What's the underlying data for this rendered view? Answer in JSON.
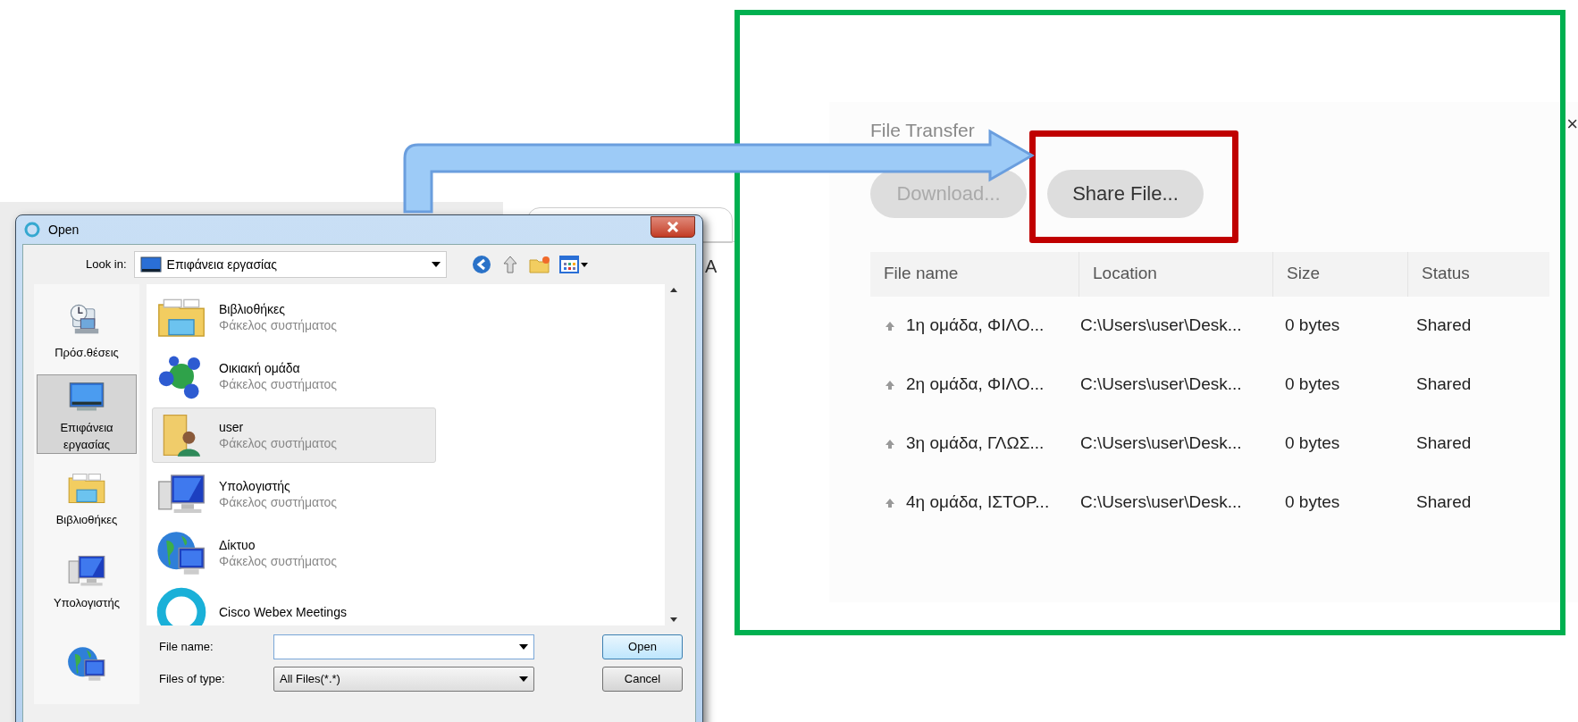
{
  "background_fragments": [
    {
      "kind": "small",
      "text": "A"
    }
  ],
  "open_dialog": {
    "title": "Open",
    "look_in_label": "Look in:",
    "look_in_value": "Επιφάνεια εργασίας",
    "places": [
      {
        "kind": "recent",
        "label": "Πρόσ.θέσεις",
        "selected": false
      },
      {
        "kind": "desktop",
        "label": "Επιφάνεια εργασίας",
        "selected": true
      },
      {
        "kind": "libraries",
        "label": "Βιβλιοθήκες",
        "selected": false
      },
      {
        "kind": "computer",
        "label": "Υπολογιστής",
        "selected": false
      },
      {
        "kind": "network",
        "selected": false
      }
    ],
    "items": [
      {
        "kind": "libraries",
        "name": "Βιβλιοθήκες",
        "type": "Φάκελος συστήματος",
        "selected": false
      },
      {
        "kind": "homegroup",
        "name": "Οικιακή ομάδα",
        "type": "Φάκελος συστήματος",
        "selected": false
      },
      {
        "kind": "user",
        "name": "user",
        "type": "Φάκελος συστήματος",
        "selected": true
      },
      {
        "kind": "computer",
        "name": "Υπολογιστής",
        "type": "Φάκελος συστήματος",
        "selected": false
      },
      {
        "kind": "network",
        "name": "Δίκτυο",
        "type": "Φάκελος συστήματος",
        "selected": false
      },
      {
        "kind": "webex",
        "name": "Cisco Webex Meetings",
        "selected": false
      }
    ],
    "file_name_label": "File name:",
    "files_of_type_label": "Files of type:",
    "files_of_type_value": "All Files(*.*)",
    "buttons": [
      "Open",
      "Cancel"
    ]
  },
  "file_transfer": {
    "title": "File Transfer",
    "close": "×",
    "buttons": [
      {
        "label": "Download...",
        "disabled": true
      },
      {
        "label": "Share File...",
        "disabled": false
      }
    ],
    "columns": [
      "File name",
      "Location",
      "Size",
      "Status"
    ],
    "rows": [
      {
        "name": "1η ομάδα, ΦΙΛΟ...",
        "location": "C:\\Users\\user\\Desk...",
        "size": "0 bytes",
        "status": "Shared"
      },
      {
        "name": "2η ομάδα, ΦΙΛΟ...",
        "location": "C:\\Users\\user\\Desk...",
        "size": "0 bytes",
        "status": "Shared"
      },
      {
        "name": "3η ομάδα, ΓΛΩΣ...",
        "location": "C:\\Users\\user\\Desk...",
        "size": "0 bytes",
        "status": "Shared"
      },
      {
        "name": "4η ομάδα, ΙΣΤΟΡ...",
        "location": "C:\\Users\\user\\Desk...",
        "size": "0 bytes",
        "status": "Shared"
      }
    ]
  }
}
